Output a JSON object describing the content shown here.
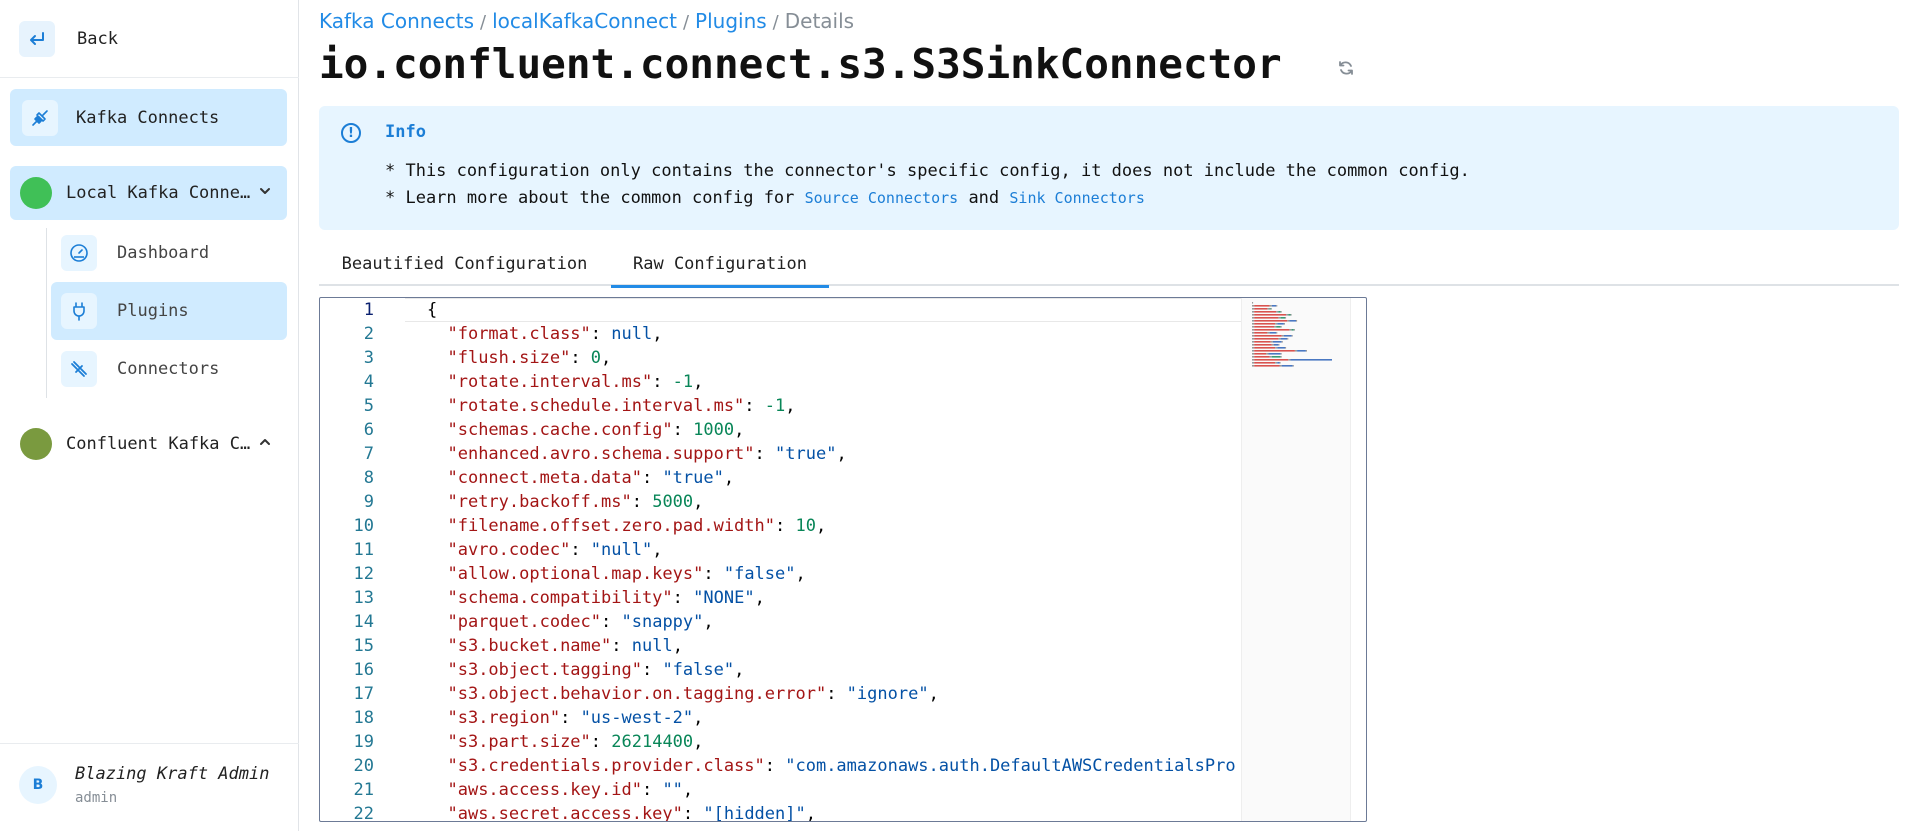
{
  "sidebar": {
    "back_label": "Back",
    "kafka_connects_label": "Kafka Connects",
    "connect_local_label": "Local Kafka Conne…",
    "connect_local_color": "#40c057",
    "sub_items": [
      {
        "label": "Dashboard",
        "icon": "gauge-icon"
      },
      {
        "label": "Plugins",
        "icon": "plug-icon"
      },
      {
        "label": "Connectors",
        "icon": "connectors-icon"
      }
    ],
    "connect_confluent_label": "Confluent Kafka C…",
    "connect_confluent_color": "#7a9a3f",
    "user": {
      "avatar_letter": "B",
      "name": "Blazing Kraft Admin",
      "role": "admin"
    }
  },
  "breadcrumb": {
    "items": [
      "Kafka Connects",
      "localKafkaConnect",
      "Plugins"
    ],
    "current": "Details"
  },
  "page_title": "io.confluent.connect.s3.S3SinkConnector",
  "info": {
    "title": "Info",
    "line1": "* This configuration only contains the connector's specific config, it does not include the common config.",
    "line2_prefix": "* Learn more about the common config for",
    "source_link": "Source Connectors",
    "and": "and",
    "sink_link": "Sink Connectors"
  },
  "tabs": [
    {
      "label": "Beautified Configuration",
      "active": false
    },
    {
      "label": "Raw Configuration",
      "active": true
    }
  ],
  "editor": {
    "current_line": 1,
    "lines": [
      [
        {
          "t": "p",
          "v": "{"
        }
      ],
      [
        {
          "t": "p",
          "v": "  "
        },
        {
          "t": "k",
          "v": "\"format.class\""
        },
        {
          "t": "p",
          "v": ": "
        },
        {
          "t": "nl",
          "v": "null"
        },
        {
          "t": "p",
          "v": ","
        }
      ],
      [
        {
          "t": "p",
          "v": "  "
        },
        {
          "t": "k",
          "v": "\"flush.size\""
        },
        {
          "t": "p",
          "v": ": "
        },
        {
          "t": "n",
          "v": "0"
        },
        {
          "t": "p",
          "v": ","
        }
      ],
      [
        {
          "t": "p",
          "v": "  "
        },
        {
          "t": "k",
          "v": "\"rotate.interval.ms\""
        },
        {
          "t": "p",
          "v": ": "
        },
        {
          "t": "n",
          "v": "-1"
        },
        {
          "t": "p",
          "v": ","
        }
      ],
      [
        {
          "t": "p",
          "v": "  "
        },
        {
          "t": "k",
          "v": "\"rotate.schedule.interval.ms\""
        },
        {
          "t": "p",
          "v": ": "
        },
        {
          "t": "n",
          "v": "-1"
        },
        {
          "t": "p",
          "v": ","
        }
      ],
      [
        {
          "t": "p",
          "v": "  "
        },
        {
          "t": "k",
          "v": "\"schemas.cache.config\""
        },
        {
          "t": "p",
          "v": ": "
        },
        {
          "t": "n",
          "v": "1000"
        },
        {
          "t": "p",
          "v": ","
        }
      ],
      [
        {
          "t": "p",
          "v": "  "
        },
        {
          "t": "k",
          "v": "\"enhanced.avro.schema.support\""
        },
        {
          "t": "p",
          "v": ": "
        },
        {
          "t": "s",
          "v": "\"true\""
        },
        {
          "t": "p",
          "v": ","
        }
      ],
      [
        {
          "t": "p",
          "v": "  "
        },
        {
          "t": "k",
          "v": "\"connect.meta.data\""
        },
        {
          "t": "p",
          "v": ": "
        },
        {
          "t": "s",
          "v": "\"true\""
        },
        {
          "t": "p",
          "v": ","
        }
      ],
      [
        {
          "t": "p",
          "v": "  "
        },
        {
          "t": "k",
          "v": "\"retry.backoff.ms\""
        },
        {
          "t": "p",
          "v": ": "
        },
        {
          "t": "n",
          "v": "5000"
        },
        {
          "t": "p",
          "v": ","
        }
      ],
      [
        {
          "t": "p",
          "v": "  "
        },
        {
          "t": "k",
          "v": "\"filename.offset.zero.pad.width\""
        },
        {
          "t": "p",
          "v": ": "
        },
        {
          "t": "n",
          "v": "10"
        },
        {
          "t": "p",
          "v": ","
        }
      ],
      [
        {
          "t": "p",
          "v": "  "
        },
        {
          "t": "k",
          "v": "\"avro.codec\""
        },
        {
          "t": "p",
          "v": ": "
        },
        {
          "t": "s",
          "v": "\"null\""
        },
        {
          "t": "p",
          "v": ","
        }
      ],
      [
        {
          "t": "p",
          "v": "  "
        },
        {
          "t": "k",
          "v": "\"allow.optional.map.keys\""
        },
        {
          "t": "p",
          "v": ": "
        },
        {
          "t": "s",
          "v": "\"false\""
        },
        {
          "t": "p",
          "v": ","
        }
      ],
      [
        {
          "t": "p",
          "v": "  "
        },
        {
          "t": "k",
          "v": "\"schema.compatibility\""
        },
        {
          "t": "p",
          "v": ": "
        },
        {
          "t": "s",
          "v": "\"NONE\""
        },
        {
          "t": "p",
          "v": ","
        }
      ],
      [
        {
          "t": "p",
          "v": "  "
        },
        {
          "t": "k",
          "v": "\"parquet.codec\""
        },
        {
          "t": "p",
          "v": ": "
        },
        {
          "t": "s",
          "v": "\"snappy\""
        },
        {
          "t": "p",
          "v": ","
        }
      ],
      [
        {
          "t": "p",
          "v": "  "
        },
        {
          "t": "k",
          "v": "\"s3.bucket.name\""
        },
        {
          "t": "p",
          "v": ": "
        },
        {
          "t": "nl",
          "v": "null"
        },
        {
          "t": "p",
          "v": ","
        }
      ],
      [
        {
          "t": "p",
          "v": "  "
        },
        {
          "t": "k",
          "v": "\"s3.object.tagging\""
        },
        {
          "t": "p",
          "v": ": "
        },
        {
          "t": "s",
          "v": "\"false\""
        },
        {
          "t": "p",
          "v": ","
        }
      ],
      [
        {
          "t": "p",
          "v": "  "
        },
        {
          "t": "k",
          "v": "\"s3.object.behavior.on.tagging.error\""
        },
        {
          "t": "p",
          "v": ": "
        },
        {
          "t": "s",
          "v": "\"ignore\""
        },
        {
          "t": "p",
          "v": ","
        }
      ],
      [
        {
          "t": "p",
          "v": "  "
        },
        {
          "t": "k",
          "v": "\"s3.region\""
        },
        {
          "t": "p",
          "v": ": "
        },
        {
          "t": "s",
          "v": "\"us-west-2\""
        },
        {
          "t": "p",
          "v": ","
        }
      ],
      [
        {
          "t": "p",
          "v": "  "
        },
        {
          "t": "k",
          "v": "\"s3.part.size\""
        },
        {
          "t": "p",
          "v": ": "
        },
        {
          "t": "n",
          "v": "26214400"
        },
        {
          "t": "p",
          "v": ","
        }
      ],
      [
        {
          "t": "p",
          "v": "  "
        },
        {
          "t": "k",
          "v": "\"s3.credentials.provider.class\""
        },
        {
          "t": "p",
          "v": ": "
        },
        {
          "t": "s",
          "v": "\"com.amazonaws.auth.DefaultAWSCredentialsPro"
        }
      ],
      [
        {
          "t": "p",
          "v": "  "
        },
        {
          "t": "k",
          "v": "\"aws.access.key.id\""
        },
        {
          "t": "p",
          "v": ": "
        },
        {
          "t": "s",
          "v": "\"\""
        },
        {
          "t": "p",
          "v": ","
        }
      ],
      [
        {
          "t": "p",
          "v": "  "
        },
        {
          "t": "k",
          "v": "\"aws.secret.access.key\""
        },
        {
          "t": "p",
          "v": ": "
        },
        {
          "t": "s",
          "v": "\"[hidden]\""
        },
        {
          "t": "p",
          "v": ","
        }
      ]
    ]
  }
}
